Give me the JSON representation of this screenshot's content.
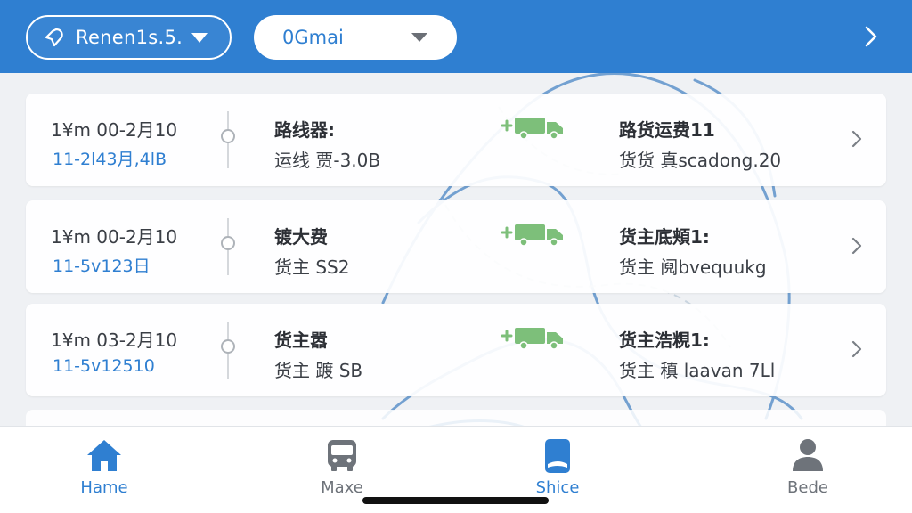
{
  "header": {
    "city_label": "Renen1s.5.",
    "filter_label": "0Gmai"
  },
  "orders": [
    {
      "date": "1¥m 00-2月10",
      "sub": "11-2l43月,4lB",
      "mid_title": "路线器:",
      "mid_sub": "运线 贾-3.0B",
      "right_title": "路货运费11",
      "right_sub": "货货 真scadong.20"
    },
    {
      "date": "1¥m 00-2月10",
      "sub": "11-5v123日",
      "mid_title": "镀大费",
      "mid_sub": "货主 SS2",
      "right_title": "货主底頬1:",
      "right_sub": "货主 阋bvequukg"
    },
    {
      "date": "1¥m 03-2月10",
      "sub": "11-5v12510",
      "mid_title": "货主嚣",
      "mid_sub": "货主 踱 SB",
      "right_title": "货主浩粯1:",
      "right_sub": "货主 稹 laavan 7Ll"
    }
  ],
  "tabs": [
    {
      "label": "Hame",
      "icon": "home-icon",
      "active": true
    },
    {
      "label": "Maxe",
      "icon": "bus-icon",
      "active": false
    },
    {
      "label": "Shice",
      "icon": "phone-icon",
      "active": true
    },
    {
      "label": "Bede",
      "icon": "person-icon",
      "active": false
    }
  ],
  "colors": {
    "brand_blue": "#2f7fd1",
    "truck_green": "#7dbf7a",
    "map_line": "#4a86c5"
  }
}
